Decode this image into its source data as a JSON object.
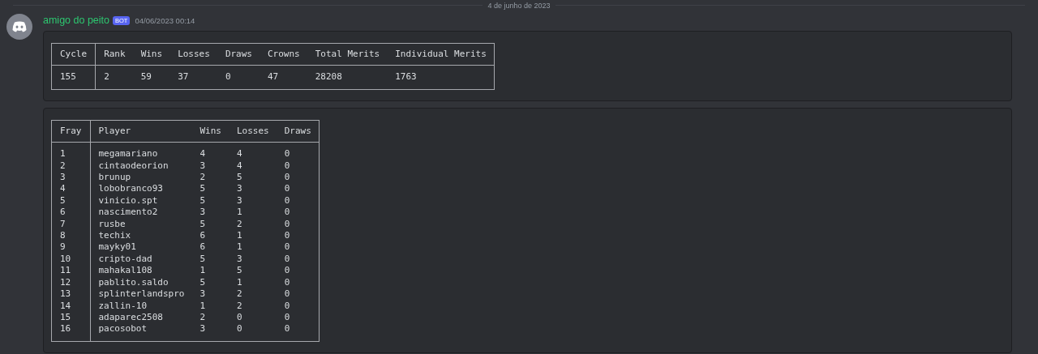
{
  "date_divider": "4 de junho de 2023",
  "message": {
    "author": "amigo do peito",
    "badge": "BOT",
    "timestamp": "04/06/2023 00:14",
    "embeds": [
      {
        "columns": [
          "Cycle",
          "Rank",
          "Wins",
          "Losses",
          "Draws",
          "Crowns",
          "Total Merits",
          "Individual Merits"
        ],
        "rows": [
          [
            "155",
            "2",
            "59",
            "37",
            "0",
            "47",
            "28208",
            "1763"
          ]
        ]
      },
      {
        "columns": [
          "Fray",
          "Player",
          "Wins",
          "Losses",
          "Draws"
        ],
        "rows": [
          [
            "1",
            "megamariano",
            "4",
            "4",
            "0"
          ],
          [
            "2",
            "cintaodeorion",
            "3",
            "4",
            "0"
          ],
          [
            "3",
            "brunup",
            "2",
            "5",
            "0"
          ],
          [
            "4",
            "lobobranco93",
            "5",
            "3",
            "0"
          ],
          [
            "5",
            "vinicio.spt",
            "5",
            "3",
            "0"
          ],
          [
            "6",
            "nascimento2",
            "3",
            "1",
            "0"
          ],
          [
            "7",
            "rusbe",
            "5",
            "2",
            "0"
          ],
          [
            "8",
            "techix",
            "6",
            "1",
            "0"
          ],
          [
            "9",
            "mayky01",
            "6",
            "1",
            "0"
          ],
          [
            "10",
            "cripto-dad",
            "5",
            "3",
            "0"
          ],
          [
            "11",
            "mahakal108",
            "1",
            "5",
            "0"
          ],
          [
            "12",
            "pablito.saldo",
            "5",
            "1",
            "0"
          ],
          [
            "13",
            "splinterlandspro",
            "3",
            "2",
            "0"
          ],
          [
            "14",
            "zallin-10",
            "1",
            "2",
            "0"
          ],
          [
            "15",
            "adaparec2508",
            "2",
            "0",
            "0"
          ],
          [
            "16",
            "pacosobot",
            "3",
            "0",
            "0"
          ]
        ]
      }
    ]
  }
}
